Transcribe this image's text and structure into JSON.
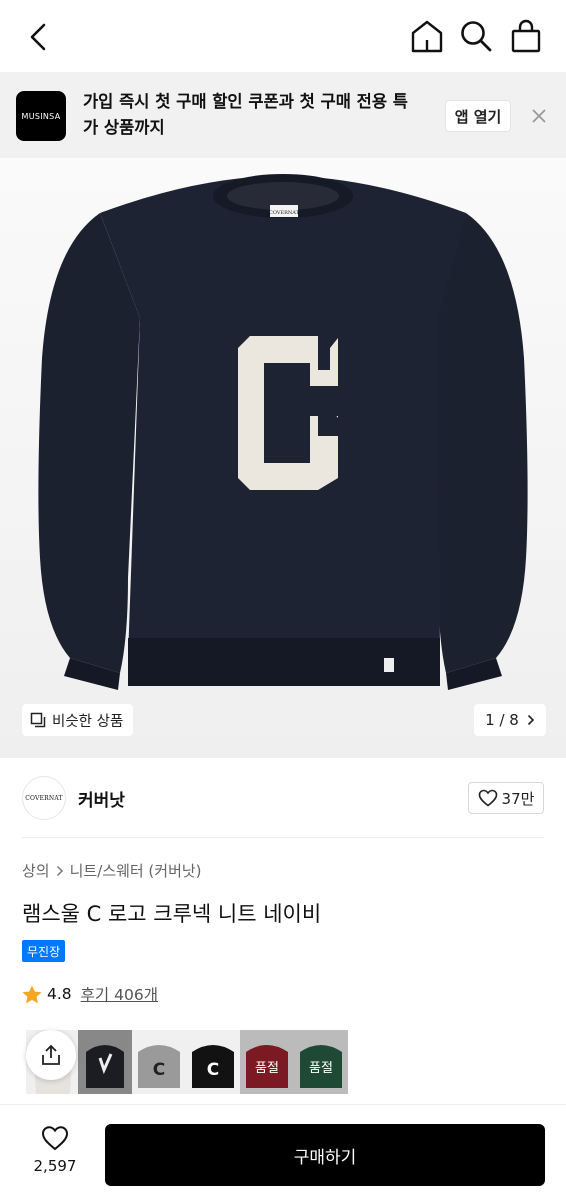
{
  "banner": {
    "logo": "MUSINSA",
    "text": "가입 즉시 첫 구매 할인 쿠폰과 첫 구매 전용 특가 상품까지",
    "open_label": "앱 열기"
  },
  "gallery": {
    "similar_label": "비슷한 상품",
    "page_indicator": "1 / 8"
  },
  "product_image": {
    "logo_letter": "C",
    "collar_tag": "COVERNAT"
  },
  "brand": {
    "logo_text": "COVERNAT",
    "name": "커버낫",
    "like_count": "37만"
  },
  "breadcrumb": {
    "category": "상의",
    "subcategory": "니트/스웨터 (커버낫)"
  },
  "product": {
    "title": "램스울 C 로고 크루넥 니트 네이비",
    "badge": "무진장",
    "rating": "4.8",
    "reviews": "후기 406개"
  },
  "swatches": [
    {
      "color": "#1b1d22",
      "mark": "heart-logo"
    },
    {
      "color": "#9a9a9a",
      "mark": "C"
    },
    {
      "color": "#121212",
      "mark": "C"
    },
    {
      "color": "#7b1a22",
      "mark": "sold",
      "label": "품절"
    },
    {
      "color": "#1e4a35",
      "mark": "sold",
      "label": "품절"
    }
  ],
  "bottom": {
    "wish_count": "2,597",
    "buy_label": "구매하기"
  },
  "colors": {
    "accent_blue": "#0078ff",
    "star": "#f5a623",
    "sweater_navy": "#1c2130"
  }
}
